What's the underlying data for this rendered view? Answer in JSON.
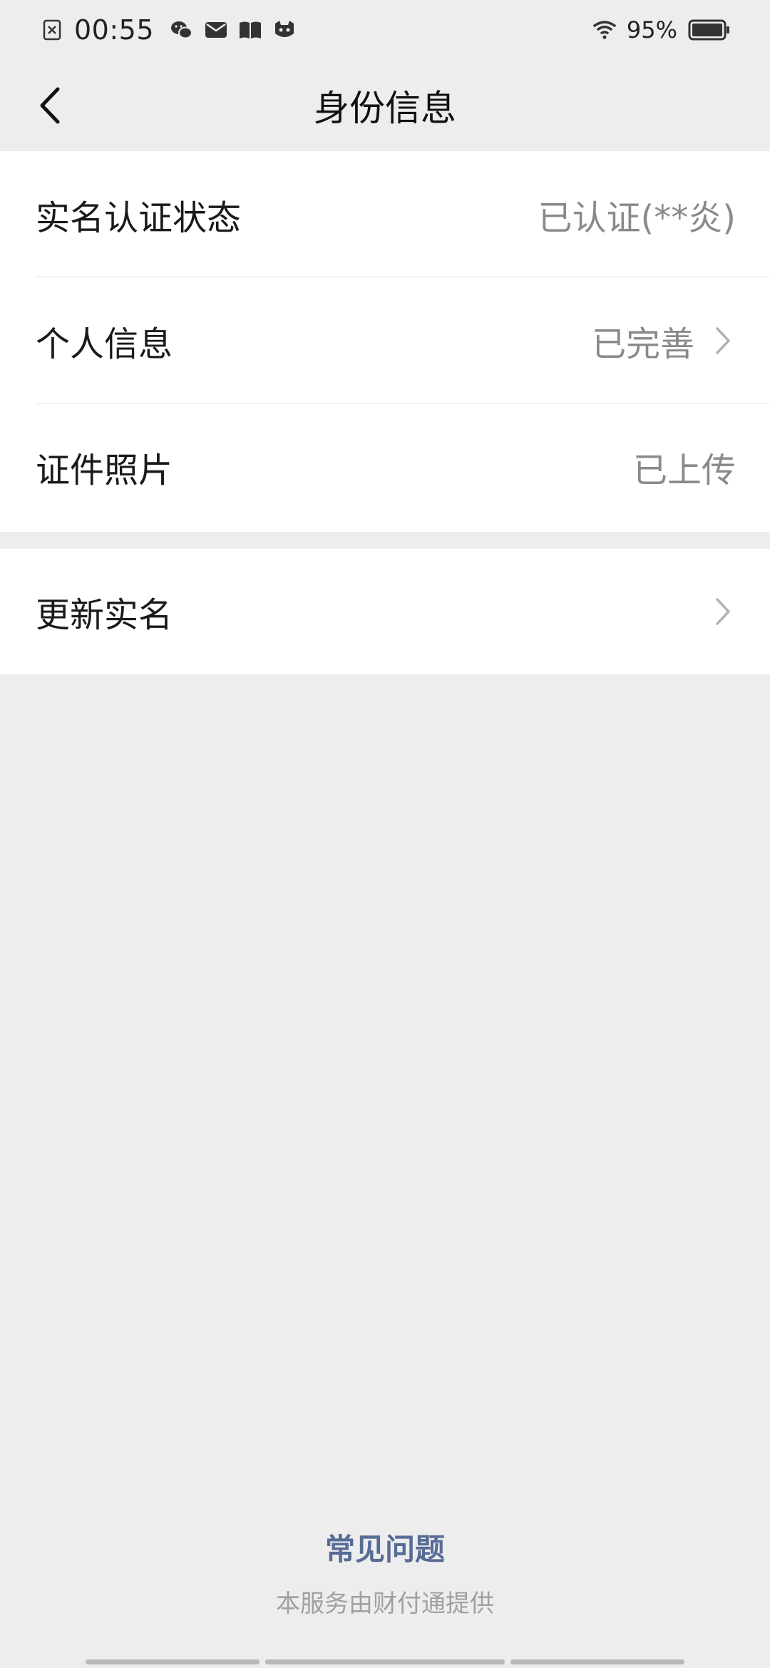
{
  "status_bar": {
    "time": "00:55",
    "battery": "95%",
    "icons_left": [
      "sim-x-icon",
      "wechat-icon",
      "mail-icon",
      "book-icon",
      "mascot-icon"
    ],
    "icons_right": [
      "wifi-icon",
      "battery-icon"
    ]
  },
  "nav": {
    "title": "身份信息",
    "back_icon": "chevron-left-icon"
  },
  "rows": [
    {
      "label": "实名认证状态",
      "value": "已认证(**炎)"
    },
    {
      "label": "个人信息",
      "value": "已完善"
    },
    {
      "label": "证件照片",
      "value": "已上传"
    },
    {
      "label": "更新实名",
      "value": ""
    }
  ],
  "footer": {
    "faq": "常见问题",
    "provider": "本服务由财付通提供"
  },
  "colors": {
    "background": "#ededed",
    "link": "#576b95",
    "secondary_text": "#8a8a8a"
  }
}
